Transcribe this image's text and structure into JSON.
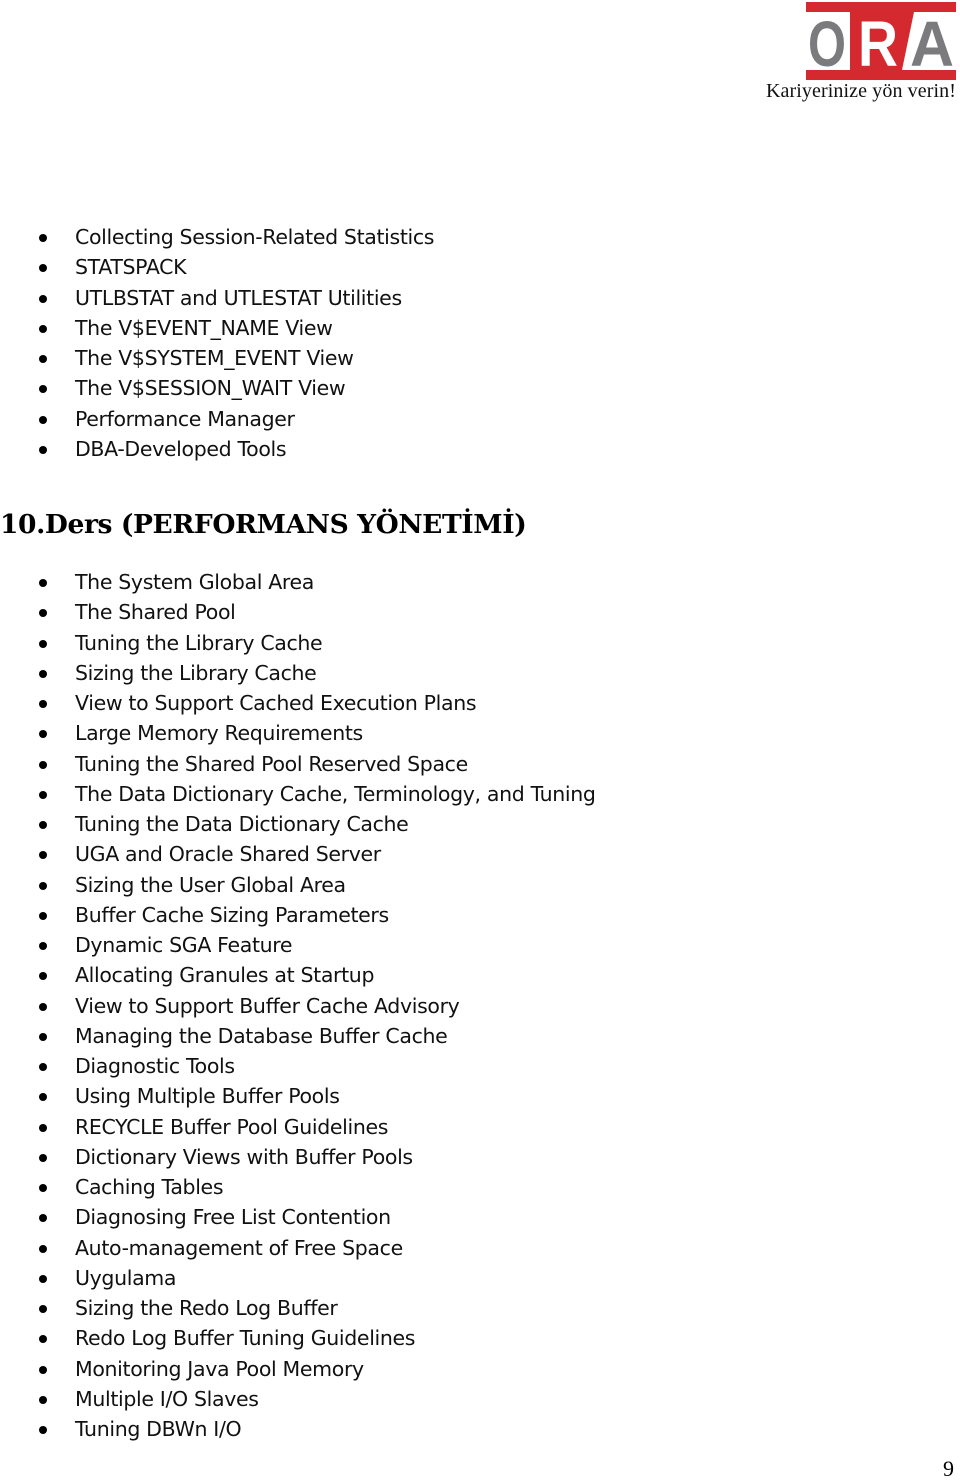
{
  "header": {
    "logo_text": "ORA",
    "logo_letters": [
      "O",
      "R",
      "A"
    ],
    "tagline": "Kariyerinize yön verin!",
    "colors": {
      "brand_red": "#d42a2f",
      "brand_gray": "#7b7b7e",
      "white": "#ffffff"
    }
  },
  "section_1": {
    "items": [
      "Collecting Session-Related Statistics",
      "STATSPACK",
      "UTLBSTAT and UTLESTAT Utilities",
      "The V$EVENT_NAME View",
      "The V$SYSTEM_EVENT View",
      "The V$SESSION_WAIT View",
      "Performance Manager",
      "DBA-Developed Tools"
    ]
  },
  "section_2": {
    "heading": "10.Ders (PERFORMANS YÖNETİMİ)",
    "items": [
      "The System Global Area",
      "The Shared Pool",
      "Tuning the Library Cache",
      "Sizing the Library Cache",
      "View to Support Cached Execution Plans",
      "Large Memory Requirements",
      "Tuning the Shared Pool Reserved Space",
      "The Data Dictionary Cache, Terminology, and Tuning",
      "Tuning the Data Dictionary Cache",
      "UGA and Oracle Shared Server",
      "Sizing the User Global Area",
      "Buffer Cache Sizing Parameters",
      "Dynamic SGA Feature",
      "Allocating Granules at Startup",
      "View to Support Buffer Cache Advisory",
      "Managing the Database Buffer Cache",
      "Diagnostic Tools",
      "Using Multiple Buffer Pools",
      "RECYCLE Buffer Pool Guidelines",
      "Dictionary Views with Buffer Pools",
      "Caching Tables",
      "Diagnosing Free List Contention",
      "Auto-management of Free Space",
      "Uygulama",
      "Sizing the Redo Log Buffer",
      "Redo Log Buffer Tuning Guidelines",
      "Monitoring Java Pool Memory",
      "Multiple I/O Slaves",
      "Tuning DBWn I/O"
    ]
  },
  "footer": {
    "page_number": "9"
  }
}
